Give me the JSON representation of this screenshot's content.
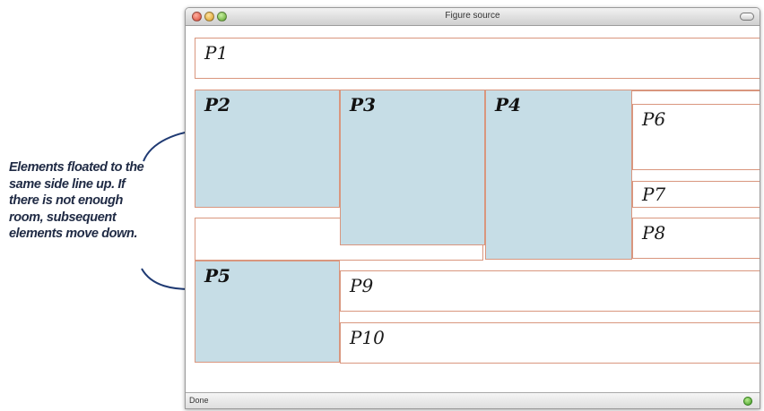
{
  "window": {
    "title": "Figure source"
  },
  "annotation": {
    "lines": [
      "Elements floated to the",
      "same side line up. If",
      "there is not enough",
      "room, subsequent",
      "elements move down."
    ]
  },
  "paragraphs": {
    "p1": "P1",
    "p2": "P2",
    "p3": "P3",
    "p4": "P4",
    "p5": "P5",
    "p6": "P6",
    "p7": "P7",
    "p8": "P8",
    "p9": "P9",
    "p10": "P10"
  },
  "status": {
    "text": "Done"
  }
}
